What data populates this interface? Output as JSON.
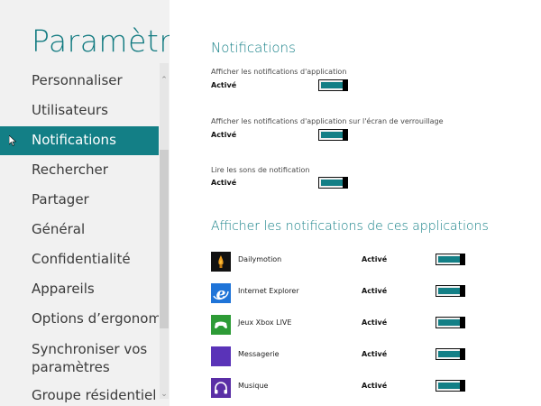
{
  "header": {
    "title": "Paramètr..."
  },
  "nav": {
    "items": [
      {
        "label": "Personnaliser"
      },
      {
        "label": "Utilisateurs"
      },
      {
        "label": "Notifications",
        "selected": true
      },
      {
        "label": "Rechercher"
      },
      {
        "label": "Partager"
      },
      {
        "label": "Général"
      },
      {
        "label": "Confidentialité"
      },
      {
        "label": "Appareils"
      },
      {
        "label": "Options d’ergonomie"
      },
      {
        "label": "Synchroniser vos paramètres"
      },
      {
        "label": "Groupe résidentiel"
      }
    ]
  },
  "colors": {
    "accent": "#137f86",
    "left_bg": "#f1f1f1"
  },
  "notifications": {
    "title": "Notifications",
    "settings": [
      {
        "label": "Afficher les notifications d'application",
        "state": "Activé",
        "on": true
      },
      {
        "label": "Afficher les notifications d'application sur l'écran de verrouillage",
        "state": "Activé",
        "on": true
      },
      {
        "label": "Lire les sons de notification",
        "state": "Activé",
        "on": true
      }
    ]
  },
  "apps_section": {
    "title": "Afficher les notifications de ces applications",
    "apps": [
      {
        "name": "Dailymotion",
        "state": "Activé",
        "icon": "dailymotion-icon",
        "icon_color": "#111111"
      },
      {
        "name": "Internet Explorer",
        "state": "Activé",
        "icon": "internet-explorer-icon",
        "icon_color": "#1f74d8"
      },
      {
        "name": "Jeux Xbox LIVE",
        "state": "Activé",
        "icon": "xbox-games-icon",
        "icon_color": "#2d9b36"
      },
      {
        "name": "Messagerie",
        "state": "Activé",
        "icon": "messaging-icon",
        "icon_color": "#5a33b8"
      },
      {
        "name": "Musique",
        "state": "Activé",
        "icon": "music-icon",
        "icon_color": "#5a2ea6"
      }
    ]
  }
}
